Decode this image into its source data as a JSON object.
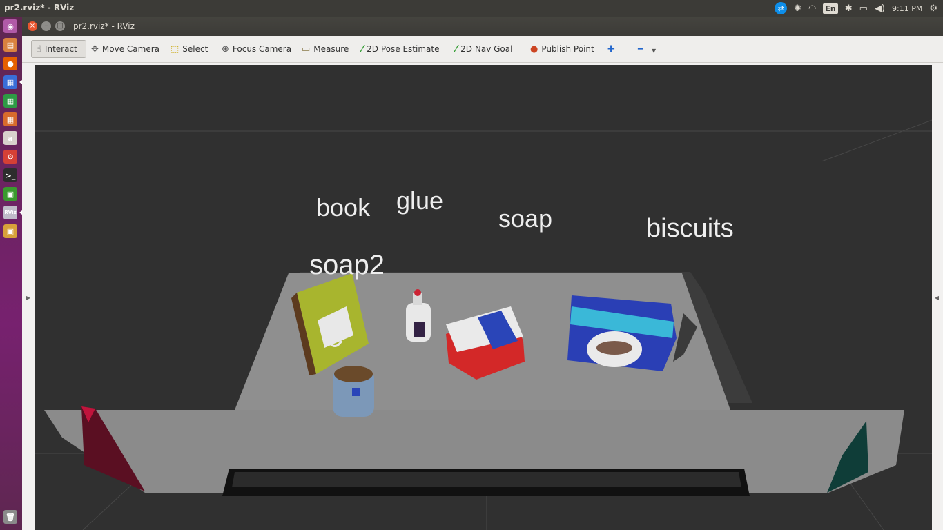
{
  "top_panel": {
    "title": "pr2.rviz* - RViz",
    "keyboard_layout": "En",
    "clock": "9:11 PM",
    "tray_icons": [
      "teamviewer-icon",
      "sync-icon",
      "wifi-icon",
      "keyboard-icon",
      "bluetooth-icon",
      "battery-icon",
      "volume-icon",
      "clock",
      "settings-gear-icon"
    ]
  },
  "launcher": {
    "items": [
      {
        "name": "dash-icon",
        "glyph": "◉",
        "color": "#b15aa7"
      },
      {
        "name": "files-icon",
        "glyph": "▤",
        "color": "#d9823f"
      },
      {
        "name": "firefox-icon",
        "glyph": "●",
        "color": "#e66000"
      },
      {
        "name": "writer-icon",
        "glyph": "▦",
        "color": "#3a6ed8"
      },
      {
        "name": "calc-icon",
        "glyph": "▦",
        "color": "#2e9a45"
      },
      {
        "name": "impress-icon",
        "glyph": "▦",
        "color": "#d86b2c"
      },
      {
        "name": "amazon-icon",
        "glyph": "a",
        "color": "#d8d2cc"
      },
      {
        "name": "system-settings-icon",
        "glyph": "⚙",
        "color": "#d54036"
      },
      {
        "name": "terminal-icon",
        "glyph": ">_",
        "color": "#2d2d2d"
      },
      {
        "name": "monitor-icon",
        "glyph": "▣",
        "color": "#3a9a2e"
      },
      {
        "name": "rviz-icon",
        "glyph": "RViz",
        "color": "#c0bcc8"
      },
      {
        "name": "gazebo-icon",
        "glyph": "▣",
        "color": "#d8a23a"
      },
      {
        "name": "trash-icon",
        "glyph": "🗑",
        "color": "#8a8a8a"
      }
    ]
  },
  "window": {
    "title": "pr2.rviz* - RViz",
    "close_glyph": "×",
    "minimize_glyph": "–",
    "maximize_glyph": "□"
  },
  "toolbar": {
    "tools": [
      {
        "name": "interact-tool",
        "label": "Interact",
        "icon": "hand-icon",
        "glyph": "☝"
      },
      {
        "name": "move-camera-tool",
        "label": "Move Camera",
        "icon": "move-camera-icon",
        "glyph": "✥"
      },
      {
        "name": "select-tool",
        "label": "Select",
        "icon": "select-box-icon",
        "glyph": "⬚"
      },
      {
        "name": "focus-camera-tool",
        "label": "Focus Camera",
        "icon": "focus-icon",
        "glyph": "⊕"
      },
      {
        "name": "measure-tool",
        "label": "Measure",
        "icon": "ruler-icon",
        "glyph": "▭"
      },
      {
        "name": "pose-estimate-tool",
        "label": "2D Pose Estimate",
        "icon": "green-arrow-icon",
        "glyph": "⁄"
      },
      {
        "name": "nav-goal-tool",
        "label": "2D Nav Goal",
        "icon": "green-arrow-icon",
        "glyph": "⁄"
      },
      {
        "name": "publish-point-tool",
        "label": "Publish Point",
        "icon": "map-pin-icon",
        "glyph": "●"
      }
    ],
    "add_glyph": "✚",
    "remove_glyph": "━",
    "dropdown_glyph": "▼"
  },
  "side_handles": {
    "left_glyph": "▶",
    "right_glyph": "◀"
  },
  "scene": {
    "labels": [
      "book",
      "glue",
      "soap",
      "biscuits",
      "soap2"
    ],
    "background_color": "#303030",
    "table_color": "#8c8c8c",
    "object_colors": {
      "book": "#a8b52e",
      "glue": "#e8e8e8",
      "soap": "#d32828",
      "soap_band": "#2a45b8",
      "biscuits": "#2a3fb5",
      "biscuits_stripe": "#3ab8d8",
      "soap2": "#7c98b8",
      "left_bin": "#5a0f22",
      "right_bin": "#0f3d38"
    }
  }
}
